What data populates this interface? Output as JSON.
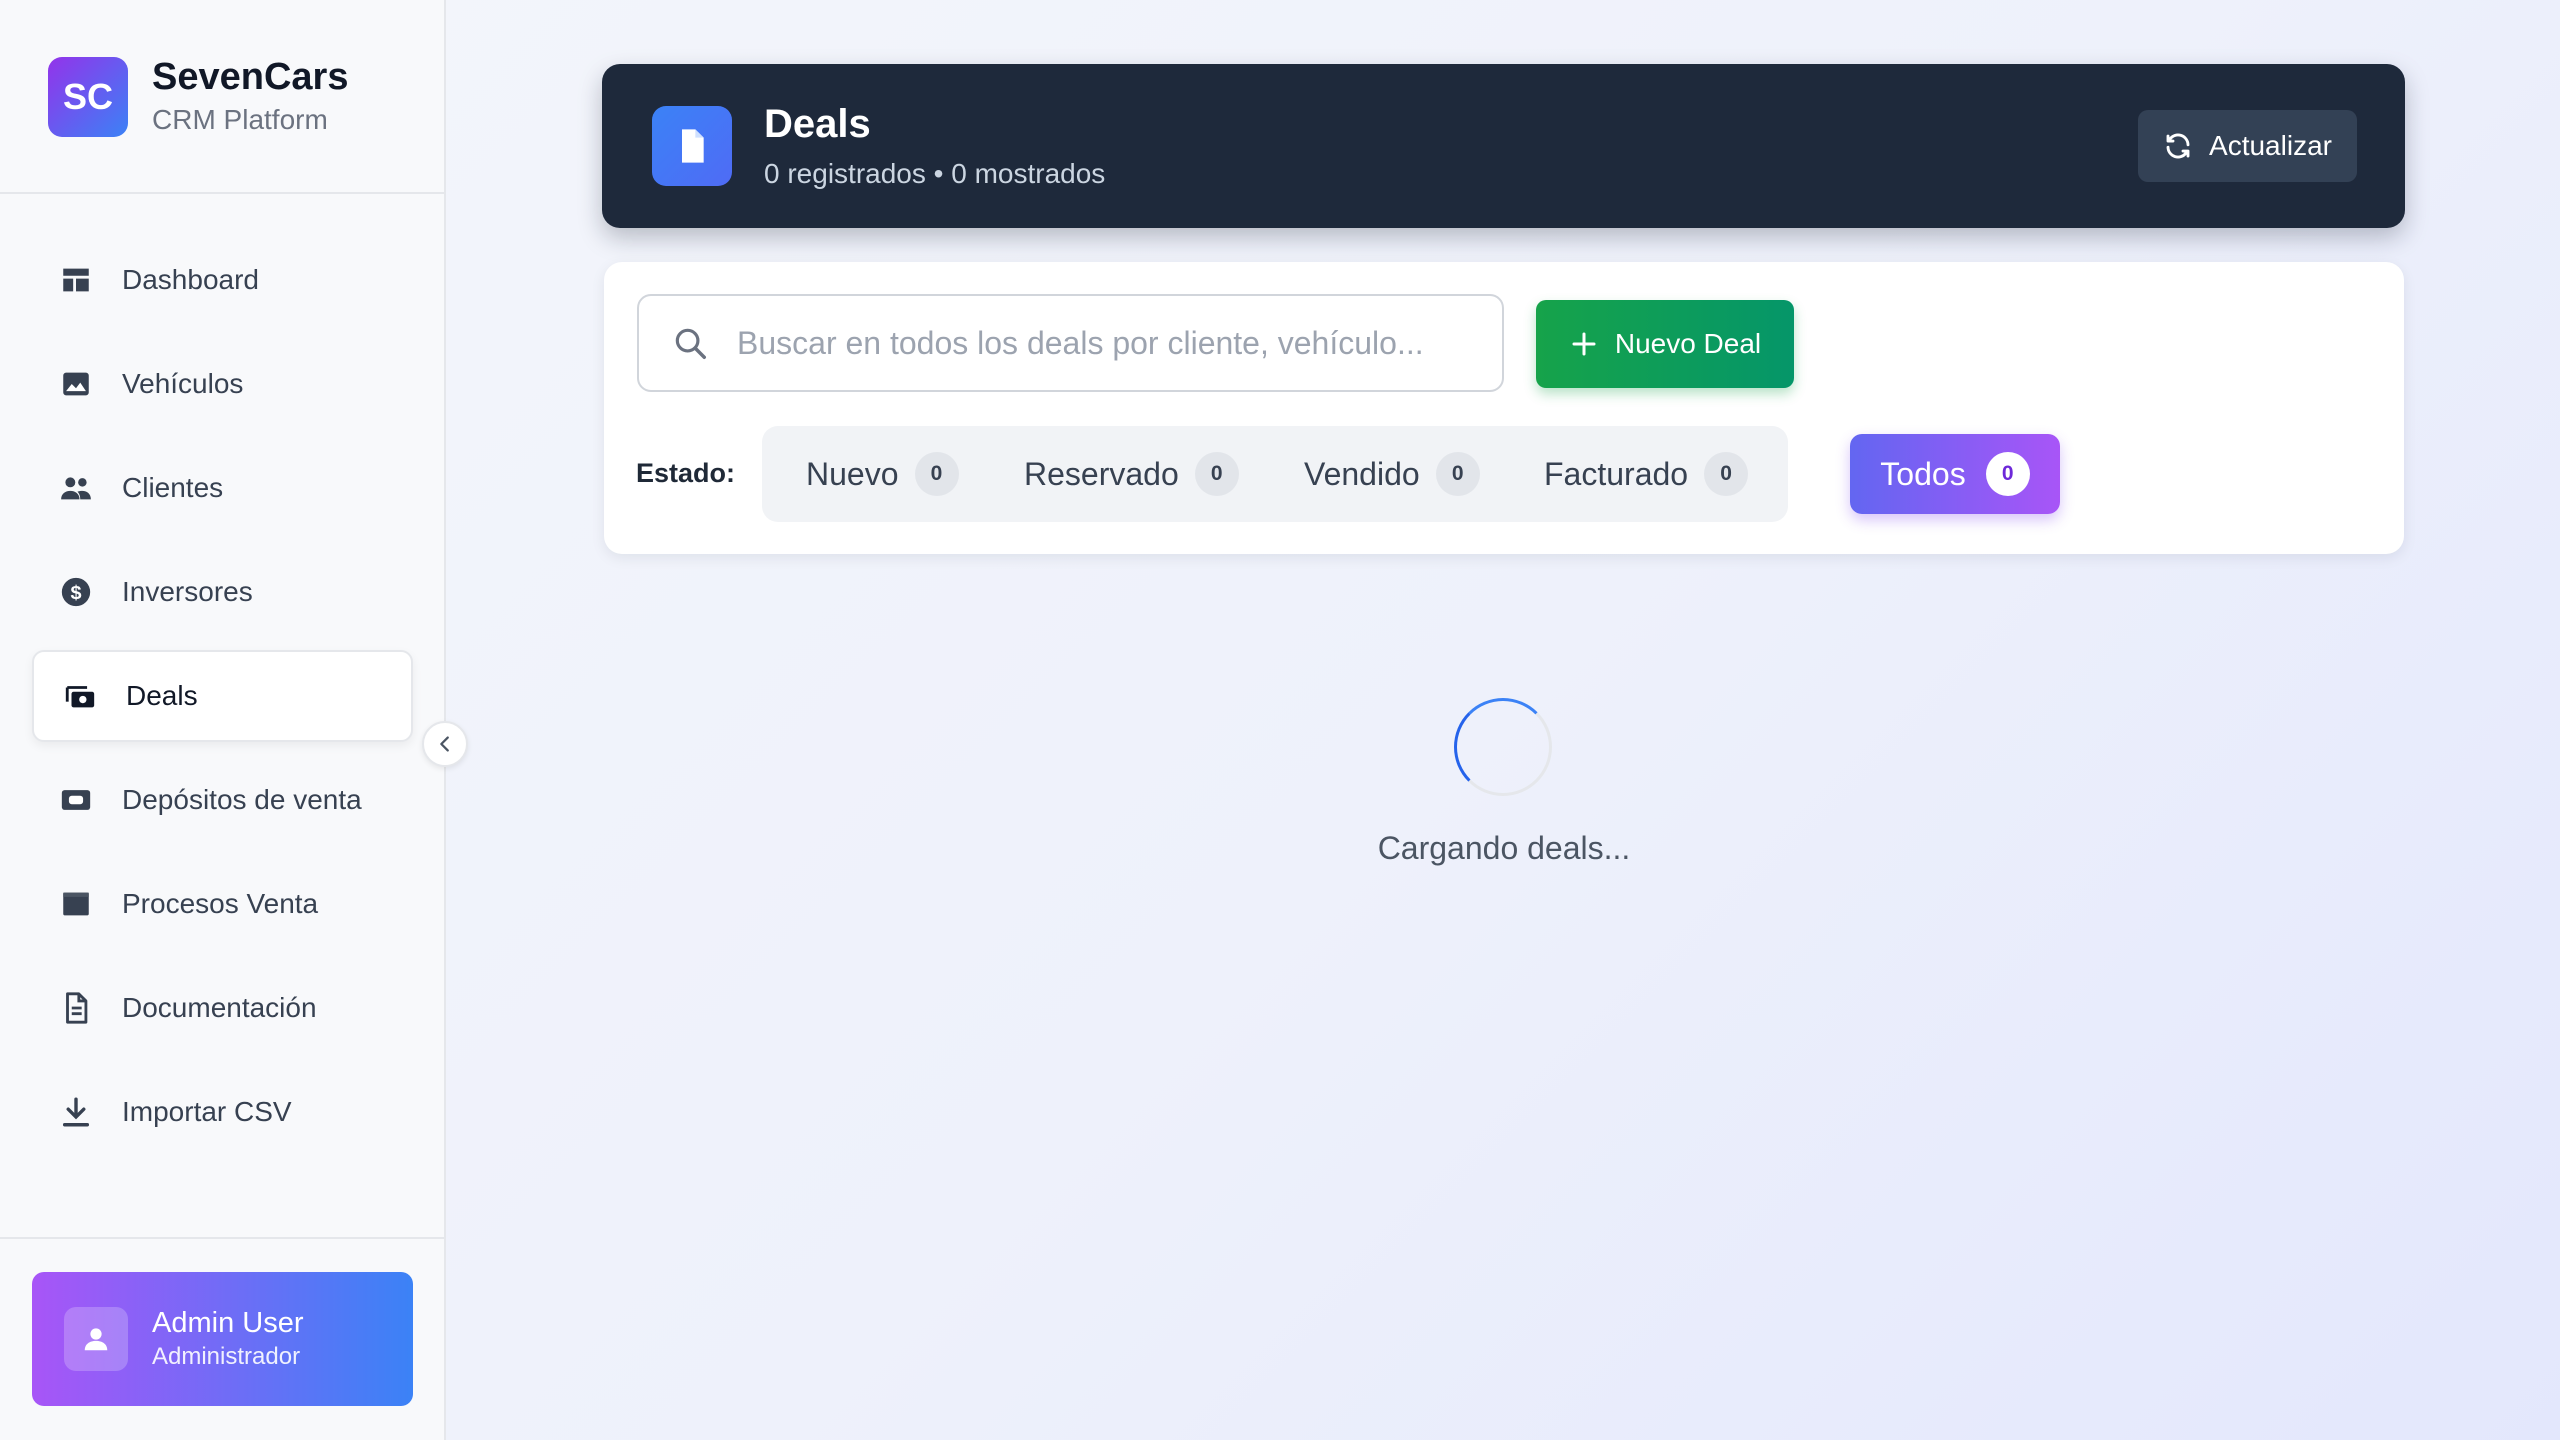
{
  "brand": {
    "logo_text": "SC",
    "name": "SevenCars",
    "subtitle": "CRM Platform"
  },
  "sidebar": {
    "items": [
      {
        "label": "Dashboard",
        "icon": "dashboard-icon"
      },
      {
        "label": "Vehículos",
        "icon": "image-icon"
      },
      {
        "label": "Clientes",
        "icon": "users-icon"
      },
      {
        "label": "Inversores",
        "icon": "dollar-icon"
      },
      {
        "label": "Deals",
        "icon": "money-stack-icon",
        "active": true
      },
      {
        "label": "Depósitos de venta",
        "icon": "wallet-icon"
      },
      {
        "label": "Procesos Venta",
        "icon": "process-icon"
      },
      {
        "label": "Documentación",
        "icon": "document-icon"
      },
      {
        "label": "Importar CSV",
        "icon": "download-icon"
      }
    ]
  },
  "user": {
    "name": "Admin User",
    "role": "Administrador",
    "icon": "user-icon"
  },
  "header": {
    "title": "Deals",
    "subtitle": "0 registrados • 0 mostrados",
    "refresh_label": "Actualizar",
    "icon": "file-icon"
  },
  "search": {
    "placeholder": "Buscar en todos los deals por cliente, vehículo...",
    "value": ""
  },
  "new_button": {
    "label": "Nuevo Deal"
  },
  "filters": {
    "estado_label": "Estado:",
    "statuses": [
      {
        "label": "Nuevo",
        "count": "0"
      },
      {
        "label": "Reservado",
        "count": "0"
      },
      {
        "label": "Vendido",
        "count": "0"
      },
      {
        "label": "Facturado",
        "count": "0"
      }
    ],
    "todos": {
      "label": "Todos",
      "count": "0"
    }
  },
  "loading": {
    "text": "Cargando deals..."
  },
  "colors": {
    "header_bg": "#1e293b",
    "primary_green": "#16a34a",
    "accent_purple": "#a855f7",
    "accent_blue": "#3b82f6"
  }
}
